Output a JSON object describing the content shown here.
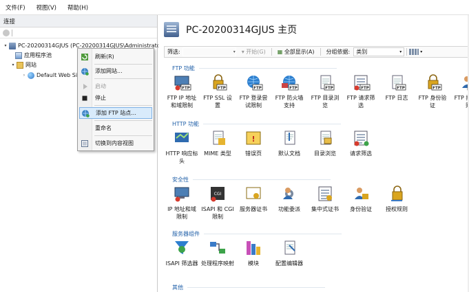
{
  "menubar": {
    "items": [
      "文件(F)",
      "视图(V)",
      "帮助(H)"
    ]
  },
  "left": {
    "header": "连接",
    "tree": [
      {
        "label": "PC-20200314GJUS (PC-20200314GJUS\\Administrator)",
        "icon": "server-icon",
        "expander": "▾"
      },
      {
        "label": "应用程序池",
        "icon": "app-pool-icon",
        "expander": ""
      },
      {
        "label": "网站",
        "icon": "sites-folder-icon",
        "expander": "▾"
      },
      {
        "label": "Default Web Site",
        "icon": "website-globe-icon",
        "expander": "›"
      }
    ]
  },
  "context_menu": {
    "items": [
      {
        "label": "刷新(R)",
        "icon": "refresh-icon",
        "disabled": false,
        "highlighted": false
      },
      {
        "label": "添加网站...",
        "icon": "add-website-icon",
        "disabled": false,
        "highlighted": false
      },
      {
        "label": "启动",
        "icon": "start-icon",
        "disabled": true,
        "highlighted": false
      },
      {
        "label": "停止",
        "icon": "stop-icon",
        "disabled": false,
        "highlighted": false
      },
      {
        "label": "添加 FTP 站点...",
        "icon": "add-ftp-site-icon",
        "disabled": false,
        "highlighted": true
      },
      {
        "label": "重命名",
        "icon": "",
        "disabled": false,
        "highlighted": false
      },
      {
        "label": "切换到内容视图",
        "icon": "content-view-icon",
        "disabled": false,
        "highlighted": false
      }
    ]
  },
  "main": {
    "title": "PC-20200314GJUS 主页",
    "filterbar": {
      "filter_label": "筛选:",
      "start_label": "▾ 开始(G)",
      "show_all_label": "全部显示(A)",
      "group_by_label": "分组依据:",
      "group_by_value": "类别"
    },
    "sections": [
      {
        "name": "FTP 功能",
        "features": [
          {
            "label": "FTP IP 地址和域限制",
            "icon": "ftp-ip-restrict-icon"
          },
          {
            "label": "FTP SSL 设置",
            "icon": "ftp-ssl-lock-icon"
          },
          {
            "label": "FTP 登录尝试限制",
            "icon": "ftp-logon-attempt-icon"
          },
          {
            "label": "FTP 防火墙支持",
            "icon": "ftp-firewall-icon"
          },
          {
            "label": "FTP 目录浏览",
            "icon": "ftp-directory-browse-icon"
          },
          {
            "label": "FTP 请求筛选",
            "icon": "ftp-request-filter-icon"
          },
          {
            "label": "FTP 日志",
            "icon": "ftp-log-icon"
          },
          {
            "label": "FTP 身份验证",
            "icon": "ftp-authentication-icon"
          },
          {
            "label": "FTP 授权规则",
            "icon": "ftp-authorization-icon"
          }
        ]
      },
      {
        "name": "HTTP 功能",
        "features": [
          {
            "label": "HTTP 响应标头",
            "icon": "http-response-headers-icon"
          },
          {
            "label": "MIME 类型",
            "icon": "mime-types-icon"
          },
          {
            "label": "错误页",
            "icon": "error-pages-icon"
          },
          {
            "label": "默认文档",
            "icon": "default-document-icon"
          },
          {
            "label": "目录浏览",
            "icon": "directory-browsing-icon"
          },
          {
            "label": "请求筛选",
            "icon": "request-filtering-icon"
          }
        ]
      },
      {
        "name": "安全性",
        "features": [
          {
            "label": "IP 地址和域限制",
            "icon": "ip-domain-restrict-icon"
          },
          {
            "label": "ISAPI 和 CGI 限制",
            "icon": "isapi-cgi-restrict-icon"
          },
          {
            "label": "服务器证书",
            "icon": "server-certificates-icon"
          },
          {
            "label": "功能委派",
            "icon": "feature-delegation-icon"
          },
          {
            "label": "集中式证书",
            "icon": "central-certificates-icon"
          },
          {
            "label": "身份验证",
            "icon": "authentication-icon"
          },
          {
            "label": "授权规则",
            "icon": "authorization-rules-icon"
          }
        ]
      },
      {
        "name": "服务器组件",
        "features": [
          {
            "label": "ISAPI 筛选器",
            "icon": "isapi-filters-icon"
          },
          {
            "label": "处理程序映射",
            "icon": "handler-mappings-icon"
          },
          {
            "label": "模块",
            "icon": "modules-icon"
          },
          {
            "label": "配置编辑器",
            "icon": "configuration-editor-icon"
          }
        ]
      },
      {
        "name": "其他",
        "features": []
      }
    ]
  }
}
